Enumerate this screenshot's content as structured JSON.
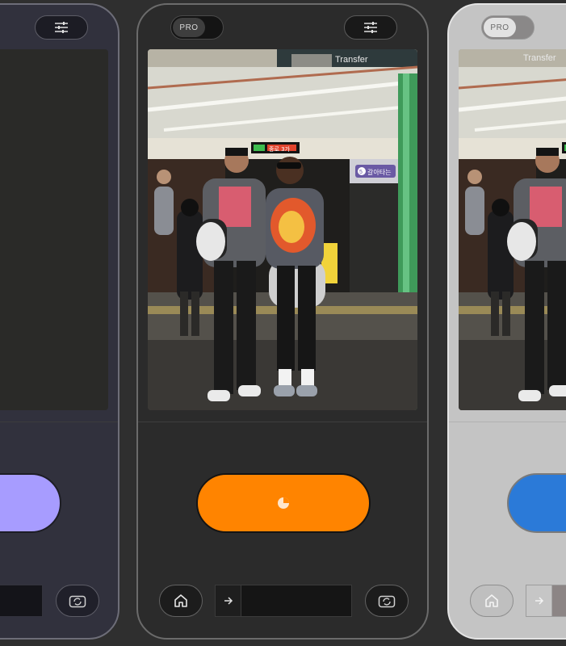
{
  "app": {
    "pro_label": "PRO"
  },
  "photo": {
    "sign_transfer": "Transfer",
    "sign_line": "5",
    "sign_platform": "갈아타는",
    "sign_display": "종로 3가"
  },
  "icons": {
    "settings": "sliders-icon",
    "capture_status": "timer-icon",
    "home": "home-icon",
    "lens_next": "arrow-right-icon",
    "flip": "camera-flip-icon"
  },
  "theme": {
    "capture_orange": "#ff8400",
    "capture_lavender": "#a79cff",
    "capture_blue": "#2b7ad8"
  }
}
